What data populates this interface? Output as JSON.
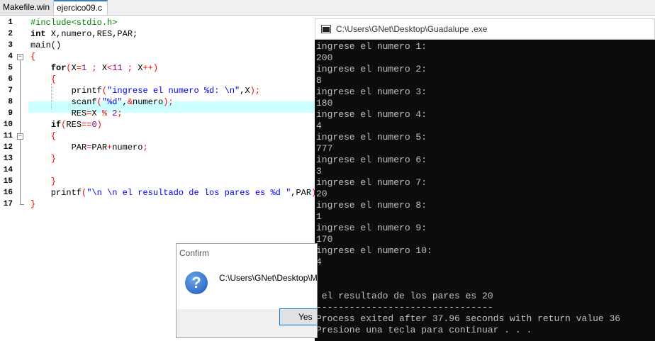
{
  "tabs": [
    "Makefile.win",
    "ejercico09.c"
  ],
  "editor": {
    "line_numbers": [
      "1",
      "2",
      "3",
      "4",
      "5",
      "6",
      "7",
      "8",
      "9",
      "10",
      "11",
      "12",
      "13",
      "14",
      "15",
      "16",
      "17"
    ]
  },
  "console": {
    "title": "C:\\Users\\GNet\\Desktop\\Guadalupe .exe",
    "lines": [
      "ingrese el numero 1:",
      "200",
      "ingrese el numero 2:",
      "8",
      "ingrese el numero 3:",
      "180",
      "ingrese el numero 4:",
      "4",
      "ingrese el numero 5:",
      "777",
      "ingrese el numero 6:",
      "3",
      "ingrese el numero 7:",
      "20",
      "ingrese el numero 8:",
      "1",
      "ingrese el numero 9:",
      "170",
      "ingrese el numero 10:",
      "4",
      "",
      "",
      " el resultado de los pares es 20",
      "--------------------------------",
      "Process exited after 37.96 seconds with return value 36",
      "Presione una tecla para continuar . . ."
    ]
  },
  "dialog": {
    "title": "Confirm",
    "message": "C:\\Users\\GNet\\Desktop\\M",
    "yes_label": "Yes"
  },
  "colors": {
    "highlight_line": "#ccffff",
    "console_bg": "#0c0c0c",
    "console_text": "#c0c0c0"
  }
}
